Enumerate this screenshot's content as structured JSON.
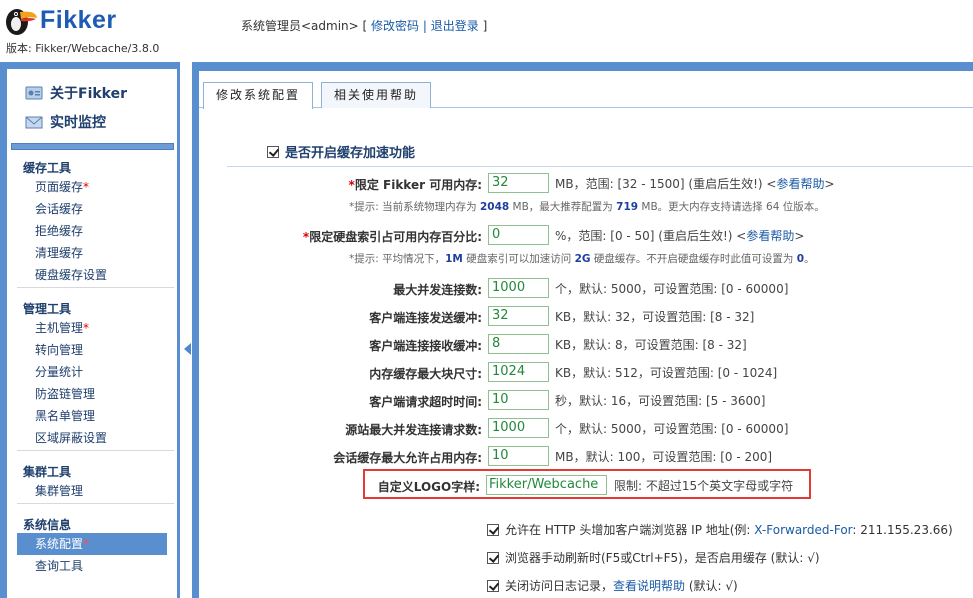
{
  "header": {
    "logo_text": "Fikker",
    "version": "版本: Fikker/Webcache/3.8.0",
    "user_prefix": "系统管理员<admin> [",
    "change_password": "修改密码",
    "separator": "|",
    "logout": "退出登录",
    "user_suffix": "]"
  },
  "sidebar": {
    "about": "关于Fikker",
    "monitor": "实时监控",
    "groups": [
      {
        "title": "缓存工具",
        "items": [
          {
            "label": "页面缓存",
            "star": "*"
          },
          {
            "label": "会话缓存",
            "star": ""
          },
          {
            "label": "拒绝缓存",
            "star": ""
          },
          {
            "label": "清理缓存",
            "star": ""
          },
          {
            "label": "硬盘缓存设置",
            "star": ""
          }
        ]
      },
      {
        "title": "管理工具",
        "items": [
          {
            "label": "主机管理",
            "star": "*"
          },
          {
            "label": "转向管理",
            "star": ""
          },
          {
            "label": "分量统计",
            "star": ""
          },
          {
            "label": "防盗链管理",
            "star": ""
          },
          {
            "label": "黑名单管理",
            "star": ""
          },
          {
            "label": "区域屏蔽设置",
            "star": ""
          }
        ]
      },
      {
        "title": "集群工具",
        "items": [
          {
            "label": "集群管理",
            "star": ""
          }
        ]
      },
      {
        "title": "系统信息",
        "items": [
          {
            "label": "系统配置",
            "star": "*"
          },
          {
            "label": "查询工具",
            "star": ""
          }
        ]
      }
    ]
  },
  "tabs": [
    {
      "label": "修改系统配置"
    },
    {
      "label": "相关使用帮助"
    }
  ],
  "form": {
    "enable_cache": "是否开启缓存加速功能",
    "mem": {
      "req": "*",
      "label": "限定 Fikker 可用内存:",
      "value": "32",
      "hint": "MB，范围: [32 - 1500] (重启后生效!)  <",
      "help": "参看帮助",
      "hint_end": ">",
      "tip_pre": "*提示: 当前系统物理内存为 ",
      "tip_b1": "2048",
      "tip_mid": " MB，最大推荐配置为 ",
      "tip_b2": "719",
      "tip_post": " MB。更大内存支持请选择 64 位版本。"
    },
    "disk": {
      "req": "*",
      "label": "限定硬盘索引占可用内存百分比:",
      "value": "0",
      "hint": "%，范围: [0 - 50] (重启后生效!)  <",
      "help": "参看帮助",
      "hint_end": ">",
      "tip_pre": "*提示: 平均情况下，",
      "tip_b1": "1M",
      "tip_mid": " 硬盘索引可以加速访问 ",
      "tip_b2": "2G",
      "tip_post": " 硬盘缓存。不开启硬盘缓存时此值可设置为 ",
      "tip_b3": "0",
      "tip_end": "。"
    },
    "rows": [
      {
        "label": "最大并发连接数:",
        "value": "1000",
        "hint": "个，默认: 5000，可设置范围: [0 - 60000]"
      },
      {
        "label": "客户端连接发送缓冲:",
        "value": "32",
        "hint": "KB，默认: 32，可设置范围: [8 - 32]"
      },
      {
        "label": "客户端连接接收缓冲:",
        "value": "8",
        "hint": "KB，默认: 8，可设置范围: [8 - 32]"
      },
      {
        "label": "内存缓存最大块尺寸:",
        "value": "1024",
        "hint": "KB，默认: 512，可设置范围: [0 - 1024]"
      },
      {
        "label": "客户端请求超时时间:",
        "value": "10",
        "hint": "秒，默认: 16，可设置范围: [5 - 3600]"
      },
      {
        "label": "源站最大并发连接请求数:",
        "value": "1000",
        "hint": "个，默认: 5000，可设置范围: [0 - 60000]"
      },
      {
        "label": "会话缓存最大允许占用内存:",
        "value": "10",
        "hint": "MB，默认: 100，可设置范围: [0 - 200]"
      }
    ],
    "logo": {
      "label": "自定义LOGO字样:",
      "value": "Fikker/Webcache",
      "hint": "限制: 不超过15个英文字母或字符"
    },
    "options": [
      {
        "pre": "允许在 HTTP 头增加客户端浏览器 IP 地址(例: ",
        "link": "X-Forwarded-For",
        "post": ": 211.155.23.66)"
      },
      {
        "pre": "浏览器手动刷新时(F5或Ctrl+F5)，是否启用缓存 (默认: √)",
        "link": "",
        "post": ""
      },
      {
        "pre": "关闭访问日志记录，",
        "link": "查看说明帮助",
        "post": " (默认: √)"
      }
    ]
  }
}
